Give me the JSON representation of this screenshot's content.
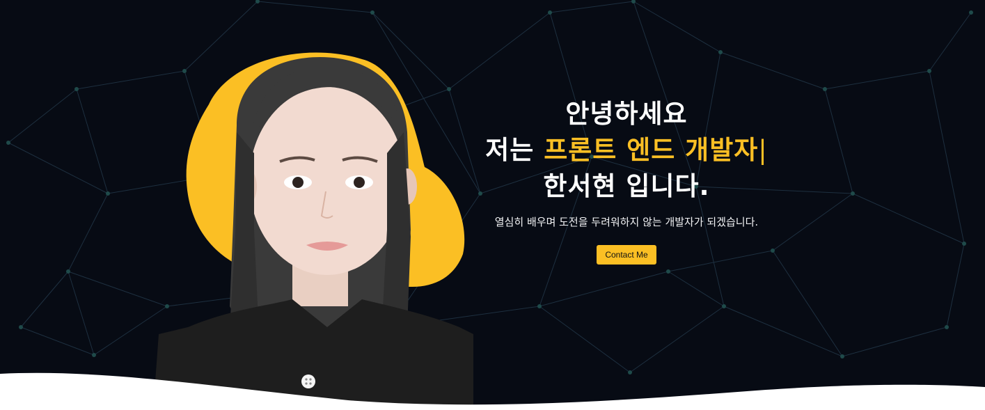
{
  "colors": {
    "background": "#070b14",
    "accent": "#fbbf24",
    "text": "#ffffff",
    "network_line": "#1e3040",
    "network_node": "#1f4a4a",
    "wave": "#ffffff"
  },
  "hero": {
    "greeting": "안녕하세요",
    "intro_prefix": "저는",
    "role": "프론트 엔드 개발자",
    "cursor": "|",
    "name_line": "한서현 입니다.",
    "tagline": "열심히 배우며 도전을 두려워하지 않는 개발자가 되겠습니다.",
    "contact_label": "Contact Me"
  },
  "images": {
    "portrait": "profile-photo",
    "backdrop": "yellow-blob"
  }
}
